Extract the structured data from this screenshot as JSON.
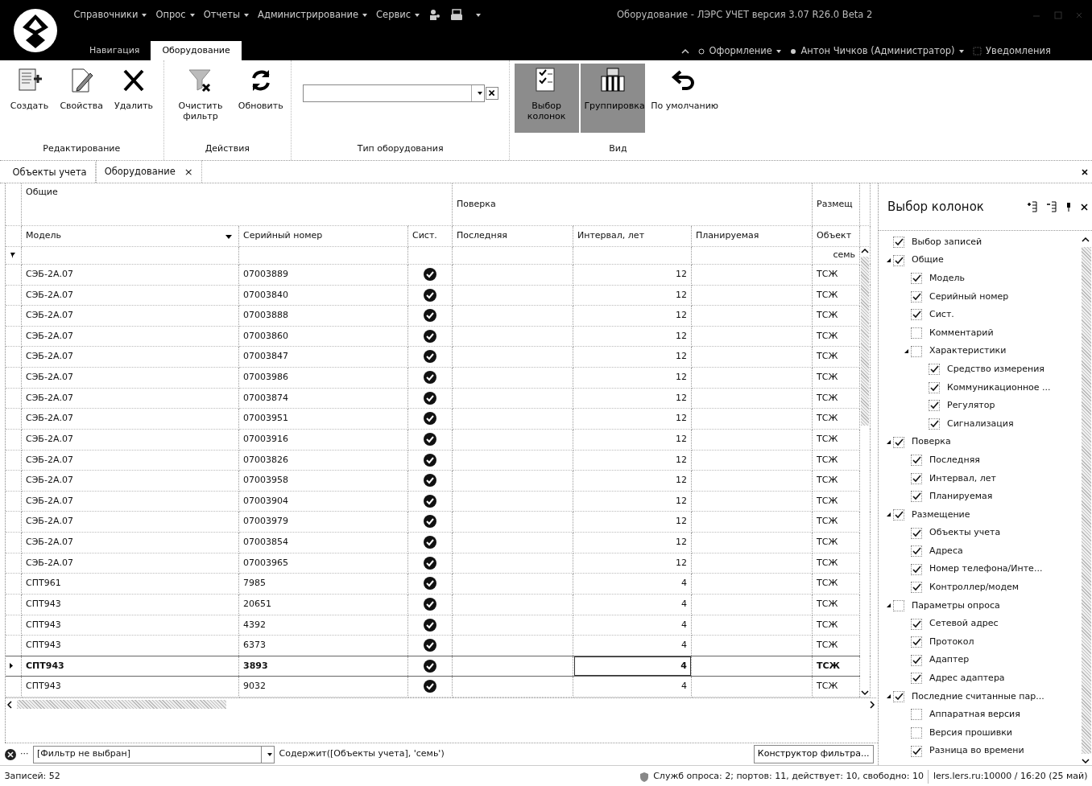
{
  "title_bar": {
    "menu": [
      {
        "label": "Справочники"
      },
      {
        "label": "Опрос"
      },
      {
        "label": "Отчеты"
      },
      {
        "label": "Администрирование"
      },
      {
        "label": "Сервис"
      }
    ],
    "title": "Оборудование - ЛЭРС УЧЕТ версия 3.07 R26.0 Beta 2"
  },
  "ribbon_tabs": [
    {
      "label": "Навигация",
      "selected": false
    },
    {
      "label": "Оборудование",
      "selected": true
    }
  ],
  "user_menu": [
    {
      "label": "Оформление"
    },
    {
      "label": "Антон Чичков (Администратор)"
    },
    {
      "label": "Уведомления"
    }
  ],
  "ribbon": {
    "groups": [
      {
        "title": "Редактирование",
        "items": [
          {
            "kind": "button",
            "label": "Создать",
            "selected": false
          },
          {
            "kind": "button",
            "label": "Свойства",
            "selected": false
          },
          {
            "kind": "button",
            "label": "Удалить",
            "selected": false
          }
        ]
      },
      {
        "title": "Действия",
        "items": [
          {
            "kind": "button",
            "label": "Очистить фильтр",
            "selected": false
          },
          {
            "kind": "button",
            "label": "Обновить",
            "selected": false
          }
        ]
      },
      {
        "title": "Тип оборудования",
        "items": [
          {
            "kind": "combo"
          }
        ]
      },
      {
        "title": "Вид",
        "items": [
          {
            "kind": "button",
            "label": "Выбор колонок",
            "selected": true
          },
          {
            "kind": "button",
            "label": "Группировка",
            "selected": true
          },
          {
            "kind": "wide",
            "label": "По умолчанию",
            "selected": false
          }
        ]
      }
    ]
  },
  "doc_tabs": [
    {
      "label": "Объекты учета",
      "selected": false
    },
    {
      "label": "Оборудование",
      "selected": true,
      "close": "×"
    }
  ],
  "grid": {
    "groups": [
      {
        "label": "Общие"
      },
      {
        "label": "Поверка"
      },
      {
        "label": "Размещ"
      }
    ],
    "columns": [
      "Модель",
      "Серийный номер",
      "Сист.",
      "Последняя",
      "Интервал, лет",
      "Планируемая",
      "Объект"
    ],
    "filter_value": "семь",
    "rows": [
      {
        "model": "СЭБ-2А.07",
        "serial": "07003889",
        "system": true,
        "interval": "12",
        "object": "ТСЖ",
        "selected": false
      },
      {
        "model": "СЭБ-2А.07",
        "serial": "07003840",
        "system": true,
        "interval": "12",
        "object": "ТСЖ",
        "selected": false
      },
      {
        "model": "СЭБ-2А.07",
        "serial": "07003888",
        "system": true,
        "interval": "12",
        "object": "ТСЖ",
        "selected": false
      },
      {
        "model": "СЭБ-2А.07",
        "serial": "07003860",
        "system": true,
        "interval": "12",
        "object": "ТСЖ",
        "selected": false
      },
      {
        "model": "СЭБ-2А.07",
        "serial": "07003847",
        "system": true,
        "interval": "12",
        "object": "ТСЖ",
        "selected": false
      },
      {
        "model": "СЭБ-2А.07",
        "serial": "07003986",
        "system": true,
        "interval": "12",
        "object": "ТСЖ",
        "selected": false
      },
      {
        "model": "СЭБ-2А.07",
        "serial": "07003874",
        "system": true,
        "interval": "12",
        "object": "ТСЖ",
        "selected": false
      },
      {
        "model": "СЭБ-2А.07",
        "serial": "07003951",
        "system": true,
        "interval": "12",
        "object": "ТСЖ",
        "selected": false
      },
      {
        "model": "СЭБ-2А.07",
        "serial": "07003916",
        "system": true,
        "interval": "12",
        "object": "ТСЖ",
        "selected": false
      },
      {
        "model": "СЭБ-2А.07",
        "serial": "07003826",
        "system": true,
        "interval": "12",
        "object": "ТСЖ",
        "selected": false
      },
      {
        "model": "СЭБ-2А.07",
        "serial": "07003958",
        "system": true,
        "interval": "12",
        "object": "ТСЖ",
        "selected": false
      },
      {
        "model": "СЭБ-2А.07",
        "serial": "07003904",
        "system": true,
        "interval": "12",
        "object": "ТСЖ",
        "selected": false
      },
      {
        "model": "СЭБ-2А.07",
        "serial": "07003979",
        "system": true,
        "interval": "12",
        "object": "ТСЖ",
        "selected": false
      },
      {
        "model": "СЭБ-2А.07",
        "serial": "07003854",
        "system": true,
        "interval": "12",
        "object": "ТСЖ",
        "selected": false
      },
      {
        "model": "СЭБ-2А.07",
        "serial": "07003965",
        "system": true,
        "interval": "12",
        "object": "ТСЖ",
        "selected": false
      },
      {
        "model": "СПТ961",
        "serial": "7985",
        "system": true,
        "interval": "4",
        "object": "ТСЖ",
        "selected": false
      },
      {
        "model": "СПТ943",
        "serial": "20651",
        "system": true,
        "interval": "4",
        "object": "ТСЖ",
        "selected": false
      },
      {
        "model": "СПТ943",
        "serial": "4392",
        "system": true,
        "interval": "4",
        "object": "ТСЖ",
        "selected": false
      },
      {
        "model": "СПТ943",
        "serial": "6373",
        "system": true,
        "interval": "4",
        "object": "ТСЖ",
        "selected": false
      },
      {
        "model": "СПТ943",
        "serial": "3893",
        "system": true,
        "interval": "4",
        "object": "ТСЖ",
        "selected": true
      },
      {
        "model": "СПТ943",
        "serial": "9032",
        "system": true,
        "interval": "4",
        "object": "ТСЖ",
        "selected": false
      }
    ]
  },
  "filter_bar": {
    "more": "···",
    "filter": "[Фильтр не выбран]",
    "expression": "Содержит([Объекты учета], 'семь')",
    "builder": "Конструктор фильтра..."
  },
  "column_panel": {
    "title": "Выбор колонок",
    "items": [
      {
        "label": "Выбор записей",
        "checked": true
      },
      {
        "label": "Общие",
        "checked": true,
        "expanded": true,
        "children": [
          {
            "label": "Модель",
            "checked": true
          },
          {
            "label": "Серийный номер",
            "checked": true
          },
          {
            "label": "Сист.",
            "checked": true
          },
          {
            "label": "Комментарий",
            "checked": false
          },
          {
            "label": "Характеристики",
            "checked": false,
            "expanded": true,
            "children": [
              {
                "label": "Средство измерения",
                "checked": true
              },
              {
                "label": "Коммуникационное ...",
                "checked": true
              },
              {
                "label": "Регулятор",
                "checked": true
              },
              {
                "label": "Сигнализация",
                "checked": true
              }
            ]
          }
        ]
      },
      {
        "label": "Поверка",
        "checked": true,
        "expanded": true,
        "children": [
          {
            "label": "Последняя",
            "checked": true
          },
          {
            "label": "Интервал, лет",
            "checked": true
          },
          {
            "label": "Планируемая",
            "checked": true
          }
        ]
      },
      {
        "label": "Размещение",
        "checked": true,
        "expanded": true,
        "children": [
          {
            "label": "Объекты учета",
            "checked": true
          },
          {
            "label": "Адреса",
            "checked": true
          },
          {
            "label": "Номер телефона/Инте...",
            "checked": true
          },
          {
            "label": "Контроллер/модем",
            "checked": true
          }
        ]
      },
      {
        "label": "Параметры опроса",
        "checked": false,
        "expanded": true,
        "children": [
          {
            "label": "Сетевой адрес",
            "checked": true
          },
          {
            "label": "Протокол",
            "checked": true
          },
          {
            "label": "Адаптер",
            "checked": true
          },
          {
            "label": "Адрес адаптера",
            "checked": true
          }
        ]
      },
      {
        "label": "Последние считанные пар...",
        "checked": true,
        "expanded": true,
        "children": [
          {
            "label": "Аппаратная версия",
            "checked": false
          },
          {
            "label": "Версия прошивки",
            "checked": false
          },
          {
            "label": "Разница во времени",
            "checked": true
          }
        ]
      }
    ]
  },
  "status_bar": {
    "records": "Записей: 52",
    "services": "Служб опроса: 2; портов: 11, действует: 10, свободно: 10",
    "server": "lers.lers.ru:10000 / 16:20 (25 май)"
  }
}
